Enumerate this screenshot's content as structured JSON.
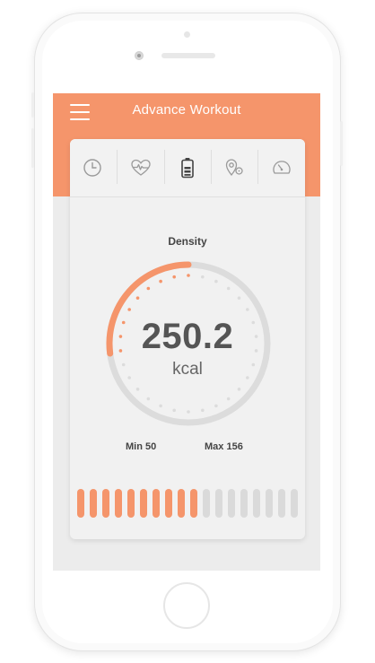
{
  "app": {
    "title": "Advance Workout"
  },
  "tabs": [
    {
      "name": "tab-time",
      "icon": "clock-icon"
    },
    {
      "name": "tab-heart-rate",
      "icon": "heart-pulse-icon"
    },
    {
      "name": "tab-battery",
      "icon": "battery-icon",
      "active": true
    },
    {
      "name": "tab-location",
      "icon": "location-pin-icon"
    },
    {
      "name": "tab-speed",
      "icon": "speedometer-icon"
    }
  ],
  "gauge": {
    "label": "Density",
    "value": "250.2",
    "unit": "kcal",
    "min_label": "Min 50",
    "max_label": "Max 156",
    "progress_fraction": 0.27
  },
  "level_bars": {
    "total": 18,
    "filled": 10
  },
  "colors": {
    "accent": "#f5956b",
    "track": "#dcdcdc",
    "inactive_bar": "#dadada",
    "text_dark": "#555555"
  }
}
